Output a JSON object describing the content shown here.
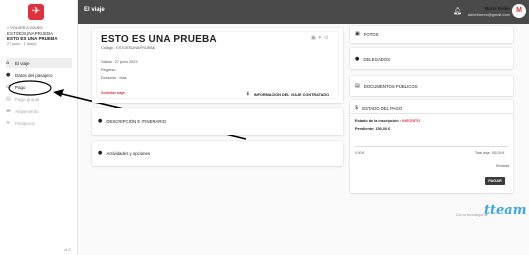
{
  "header": {
    "title": "El viaje",
    "user_name": "Marta Belén",
    "user_email": "adrieltarres@gmail.com",
    "avatar_initial": "M",
    "bell_icon": "bell-icon"
  },
  "sidebar": {
    "back_label": "< VOLVER A VIAJES",
    "trip_code": "ESTOESUNAPRUEBA",
    "trip_name": "ESTO ES UNA PRUEBA",
    "trip_dates": "27 junio - 1 día(s)",
    "items": [
      {
        "label": "El viaje",
        "icon": "home-icon",
        "glyph": "⌂"
      },
      {
        "label": "Datos del pasajero",
        "icon": "user-icon",
        "glyph": "●"
      },
      {
        "label": "Pago",
        "icon": "card-icon",
        "glyph": "▭"
      },
      {
        "label": "Pago grupal",
        "icon": "group-pay-icon",
        "glyph": "▤"
      },
      {
        "label": "Alojamiento",
        "icon": "bed-icon",
        "glyph": "▬"
      },
      {
        "label": "Pasajeros",
        "icon": "people-icon",
        "glyph": "≡"
      }
    ],
    "version": "v1.0"
  },
  "trip_card": {
    "title": "ESTO ES UNA PRUEBA",
    "code_line": "Código : ESTOESUNAPRUEBA",
    "departure": "Salida : 27 junio 2023",
    "return": "Regreso :",
    "duration": "Duración : días",
    "request_link": "Solicitar baja",
    "info_link": "INFORMACIÓN DEL VIAJE CONTRATADO"
  },
  "itinerary": {
    "label": "DESCRIPCIÓN E ITINERARIO"
  },
  "activities": {
    "label": "Actividades y opciones"
  },
  "right": {
    "photos": "FOTOS",
    "delegates": "DELEGADOS",
    "documents": "DOCUMENTOS PÚBLICOS",
    "payment_title": "ESTADO DEL PAGO",
    "status_label": "Estado de la inscripción :",
    "status_value": "INSCRITO",
    "pending_label": "Pendiente: 150,00 €",
    "amount_left": "0,00 €",
    "total_label": "Total viaje: 150,00 €",
    "restante": "Restante",
    "pay_button": "PAGAR"
  },
  "footer": {
    "text": "Con la tecnología de",
    "logo": "tteam"
  }
}
